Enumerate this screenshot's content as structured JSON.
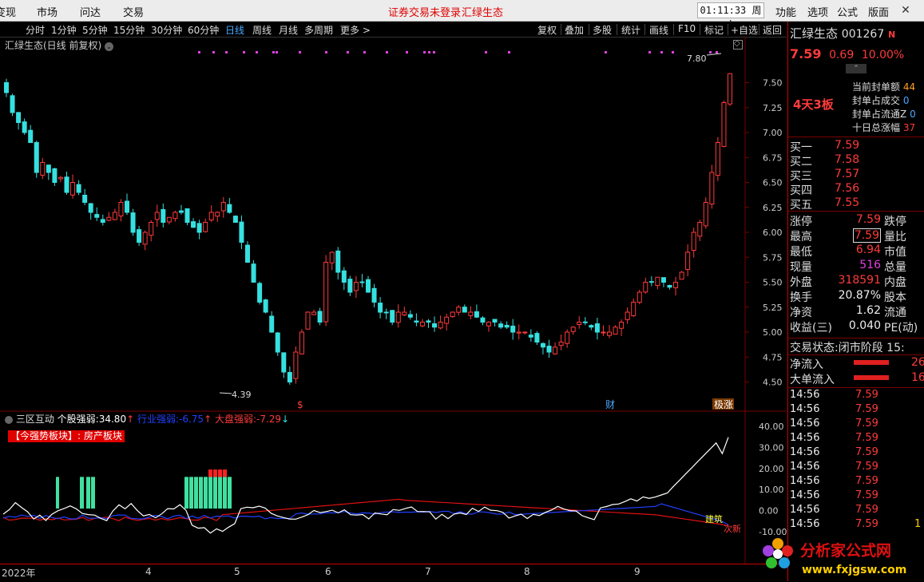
{
  "topbar": {
    "menus": [
      "变现",
      "市场",
      "问达",
      "交易"
    ],
    "notice_login": "证券交易未登录",
    "notice_stock": "汇绿生态",
    "clock": "01:11:33",
    "weekday": "周六",
    "right_menus": [
      "功能",
      "选项",
      "公式",
      "版面"
    ],
    "close": "✕"
  },
  "periodbar": {
    "periods": [
      "分时",
      "1分钟",
      "5分钟",
      "15分钟",
      "30分钟",
      "60分钟",
      "日线",
      "周线",
      "月线",
      "多周期",
      "更多 >"
    ],
    "active": "日线",
    "tools": [
      "复权",
      "叠加",
      "多股",
      "统计",
      "画线",
      "F10",
      "标记",
      "+自选",
      "返回"
    ]
  },
  "chart": {
    "title": "汇绿生态(日线 前复权)",
    "y_ticks": [
      "7.50",
      "7.25",
      "7.00",
      "6.75",
      "6.50",
      "6.25",
      "6.00",
      "5.75",
      "5.50",
      "5.25",
      "5.00",
      "4.75",
      "4.50"
    ],
    "high_label": "7.80",
    "low_label": "4.39",
    "event_markers": [
      "$",
      "财",
      "极涨"
    ],
    "x_labels": [
      "2022年",
      "4",
      "5",
      "6",
      "7",
      "8",
      "9"
    ]
  },
  "chart_data": [
    {
      "type": "candlestick",
      "title": "汇绿生态(日线 前复权)",
      "ylim": [
        4.4,
        7.8
      ],
      "y_ticks": [
        4.5,
        4.75,
        5.0,
        5.25,
        5.5,
        5.75,
        6.0,
        6.25,
        6.5,
        6.75,
        7.0,
        7.25,
        7.5
      ],
      "annotations": {
        "high": 7.8,
        "low": 4.39
      },
      "close_approx": [
        7.4,
        7.2,
        7.1,
        7.0,
        6.9,
        6.6,
        6.7,
        6.6,
        6.5,
        6.55,
        6.4,
        6.5,
        6.4,
        6.3,
        6.2,
        6.15,
        6.1,
        6.15,
        6.2,
        6.3,
        6.2,
        6.0,
        5.9,
        6.0,
        6.1,
        6.2,
        6.1,
        6.15,
        6.2,
        6.2,
        6.1,
        6.05,
        6.0,
        6.1,
        6.2,
        6.2,
        6.3,
        6.2,
        6.1,
        5.9,
        5.7,
        5.5,
        5.3,
        5.2,
        5.0,
        4.8,
        4.6,
        4.5,
        4.8,
        5.0,
        5.2,
        5.2,
        5.1,
        5.7,
        5.8,
        5.6,
        5.5,
        5.4,
        5.5,
        5.5,
        5.4,
        5.3,
        5.2,
        5.2,
        5.1,
        5.2,
        5.2,
        5.15,
        5.1,
        5.1,
        5.1,
        5.05,
        5.1,
        5.15,
        5.2,
        5.25,
        5.2,
        5.2,
        5.15,
        5.1,
        5.1,
        5.1,
        5.05,
        5.05,
        5.0,
        5.0,
        5.0,
        4.95,
        4.9,
        4.85,
        4.8,
        4.85,
        4.9,
        5.0,
        5.05,
        5.1,
        5.1,
        5.05,
        5.0,
        5.0,
        5.0,
        5.05,
        5.1,
        5.2,
        5.3,
        5.4,
        5.5,
        5.5,
        5.55,
        5.5,
        5.45,
        5.5,
        5.6,
        5.8,
        6.0,
        6.1,
        6.3,
        6.6,
        6.9,
        7.3,
        7.59
      ]
    },
    {
      "type": "line",
      "title": "三区互动",
      "ylim": [
        -10,
        40
      ],
      "y_ticks": [
        -10.0,
        0.0,
        10.0,
        20.0,
        30.0,
        40.0
      ],
      "series": [
        {
          "name": "个股强弱",
          "color": "#ffffff",
          "last": 34.8
        },
        {
          "name": "行业强弱",
          "color": "#2040ff",
          "last": -6.75
        },
        {
          "name": "大盘强弱",
          "color": "#ff2020",
          "last": -7.29
        }
      ],
      "line_labels": [
        "建筑",
        "次新"
      ]
    }
  ],
  "indicator": {
    "name": "三区互动",
    "stock_strength_label": "个股强弱:",
    "stock_strength_value": "34.80",
    "sector_strength_label": "行业强弱:",
    "sector_strength_value": "-6.75",
    "market_strength_label": "大盘强弱:",
    "market_strength_value": "-7.29",
    "badge": "【今强势板块】: 房产板块",
    "y_ticks": [
      "40.00",
      "30.00",
      "20.00",
      "10.00",
      "0.00",
      "-10.00"
    ]
  },
  "quote": {
    "name": "汇绿生态",
    "code": "001267",
    "tag": "N",
    "price": "7.59",
    "change": "0.69",
    "pct": "10.00%",
    "board_tag": "4天3板",
    "seal_rows": [
      {
        "label": "当前封单额",
        "value": "44"
      },
      {
        "label": "封单占成交",
        "value": "0"
      },
      {
        "label": "封单占流通Z",
        "value": "0"
      },
      {
        "label": "十日总涨幅",
        "value": "37"
      }
    ],
    "bids": [
      {
        "label": "买一",
        "price": "7.59"
      },
      {
        "label": "买二",
        "price": "7.58"
      },
      {
        "label": "买三",
        "price": "7.57"
      },
      {
        "label": "买四",
        "price": "7.56"
      },
      {
        "label": "买五",
        "price": "7.55"
      }
    ],
    "stats": [
      {
        "l1": "涨停",
        "v1": "7.59",
        "l2": "跌停"
      },
      {
        "l1": "最高",
        "v1": "7.59",
        "l2": "量比"
      },
      {
        "l1": "最低",
        "v1": "6.94",
        "l2": "市值"
      },
      {
        "l1": "现量",
        "v1": "516",
        "l2": "总量"
      },
      {
        "l1": "外盘",
        "v1": "318591",
        "l2": "内盘"
      },
      {
        "l1": "换手",
        "v1": "20.87%",
        "l2": "股本"
      },
      {
        "l1": "净资",
        "v1": "1.62",
        "l2": "流通"
      },
      {
        "l1": "收益(三)",
        "v1": "0.040",
        "l2": "PE(动)"
      }
    ],
    "trade_status_label": "交易状态:",
    "trade_status_value": "闭市阶段",
    "trade_status_time": "15:",
    "net_inflow_label": "净流入",
    "net_inflow_value": "26",
    "big_inflow_label": "大单流入",
    "big_inflow_value": "16",
    "ticks": [
      {
        "time": "14:56",
        "price": "7.59"
      },
      {
        "time": "14:56",
        "price": "7.59"
      },
      {
        "time": "14:56",
        "price": "7.59"
      },
      {
        "time": "14:56",
        "price": "7.59"
      },
      {
        "time": "14:56",
        "price": "7.59"
      },
      {
        "time": "14:56",
        "price": "7.59"
      },
      {
        "time": "14:56",
        "price": "7.59"
      },
      {
        "time": "14:56",
        "price": "7.59"
      },
      {
        "time": "14:56",
        "price": "7.59"
      },
      {
        "time": "14:56",
        "price": "7.59"
      }
    ],
    "last_tick_vol": "1"
  },
  "watermark": {
    "brand": "分析家公式网",
    "url": "www.fxjgsw.com"
  },
  "colors": {
    "up": "#ff3b3b",
    "down": "#36e0e0",
    "accent_blue": "#4aa8ff",
    "magenta": "#e040e0"
  }
}
